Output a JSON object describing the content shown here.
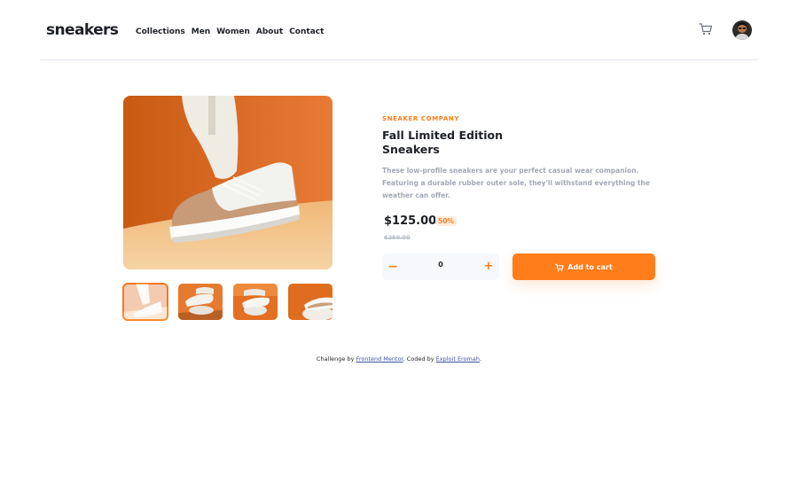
{
  "header": {
    "logo": "sneakers",
    "nav": [
      "Collections",
      "Men",
      "Women",
      "About",
      "Contact"
    ],
    "cart_icon": "cart-icon",
    "avatar_icon": "user-avatar"
  },
  "gallery": {
    "main_icon": "product-image",
    "thumbnails": [
      "thumbnail-1",
      "thumbnail-2",
      "thumbnail-3",
      "thumbnail-4"
    ],
    "active_thumbnail": 0
  },
  "product": {
    "company": "SNEAKER COMPANY",
    "title": "Fall Limited Edition Sneakers",
    "description": "These low-profile sneakers are your perfect casual wear companion. Featuring a durable rubber outer sole, they'll withstand everything the weather can offer.",
    "price": "$125.00",
    "discount": "50%",
    "old_price": "$250.00"
  },
  "quantity": {
    "minus": "−",
    "value": "0",
    "plus": "+"
  },
  "cart_button": {
    "label": "Add to cart",
    "icon": "cart-icon"
  },
  "footer": {
    "prefix": "Challenge by",
    "link1": "Frontend Mentor",
    "middle": ". Coded by",
    "link2": "Exploit Eromah",
    "suffix": "."
  },
  "colors": {
    "accent": "#ff7d1a",
    "accent_pale": "#ffede0",
    "text_dark": "#1d2026",
    "text_muted": "#a3a8b5",
    "link": "#3e52a3"
  }
}
